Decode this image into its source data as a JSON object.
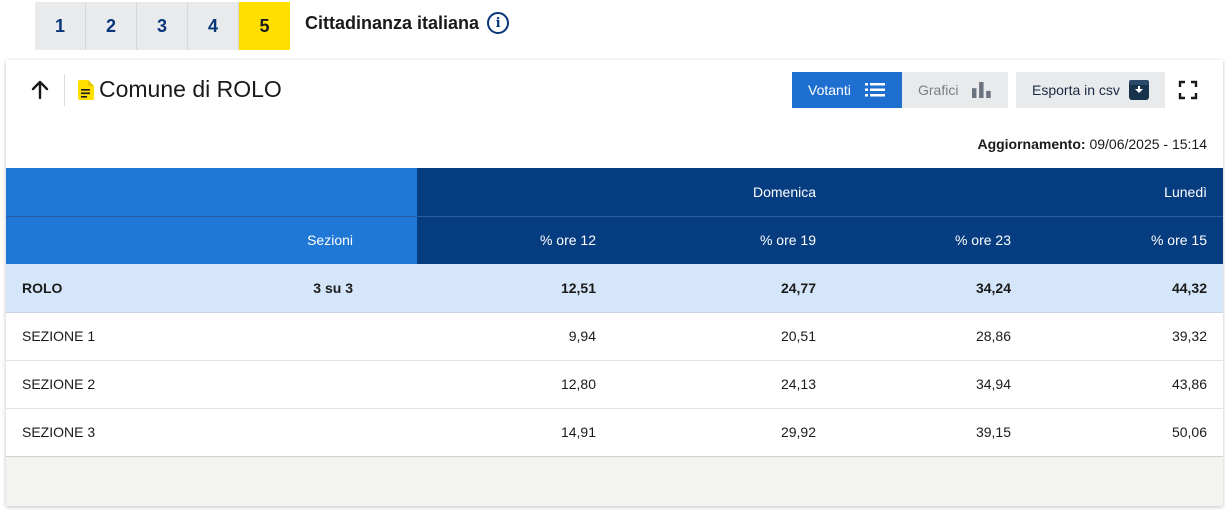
{
  "ballot_tabs": [
    "1",
    "2",
    "3",
    "4",
    "5"
  ],
  "ballot_active": "5",
  "ballot_title": "Cittadinanza italiana",
  "info_icon_glyph": "i",
  "header": {
    "place": "Comune di ROLO",
    "toggle_votanti": "Votanti",
    "toggle_grafici": "Grafici",
    "export_label": "Esporta in csv"
  },
  "update": {
    "label": "Aggiornamento:",
    "value": "09/06/2025 - 15:14"
  },
  "table": {
    "group_headers": {
      "domenica": "Domenica",
      "lunedi": "Lunedì"
    },
    "columns": [
      "",
      "Sezioni",
      "% ore 12",
      "% ore 19",
      "% ore 23",
      "% ore 15"
    ],
    "total": {
      "name": "ROLO",
      "sezioni": "3 su 3",
      "v12": "12,51",
      "v19": "24,77",
      "v23": "34,24",
      "v15": "44,32"
    },
    "rows": [
      {
        "name": "SEZIONE 1",
        "sezioni": "",
        "v12": "9,94",
        "v19": "20,51",
        "v23": "28,86",
        "v15": "39,32"
      },
      {
        "name": "SEZIONE 2",
        "sezioni": "",
        "v12": "12,80",
        "v19": "24,13",
        "v23": "34,94",
        "v15": "43,86"
      },
      {
        "name": "SEZIONE 3",
        "sezioni": "",
        "v12": "14,91",
        "v19": "29,92",
        "v23": "39,15",
        "v15": "50,06"
      }
    ]
  },
  "colors": {
    "active_tab": "#ffdf00",
    "primary_blue": "#1f6fd1",
    "dark_blue": "#063d80",
    "total_row": "#d5e6fa",
    "doc_icon": "#ffdf00"
  }
}
